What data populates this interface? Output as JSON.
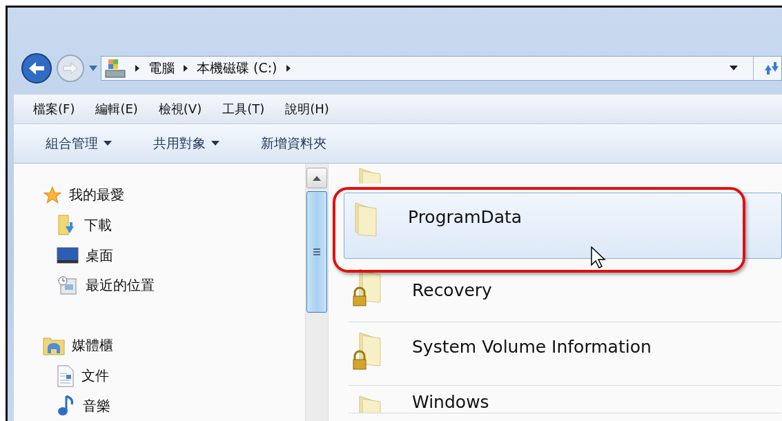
{
  "address_bar": {
    "crumbs": [
      "電腦",
      "本機磁碟 (C:)"
    ]
  },
  "menu_bar": [
    "檔案(F)",
    "編輯(E)",
    "檢視(V)",
    "工具(T)",
    "說明(H)"
  ],
  "command_bar": [
    {
      "label": "組合管理",
      "dropdown": true
    },
    {
      "label": "共用對象",
      "dropdown": true
    },
    {
      "label": "新增資料夾",
      "dropdown": false
    }
  ],
  "nav_pane": [
    {
      "label": "我的最愛",
      "kind": "favorites",
      "children": [
        {
          "label": "下載",
          "kind": "downloads"
        },
        {
          "label": "桌面",
          "kind": "desktop"
        },
        {
          "label": "最近的位置",
          "kind": "recent"
        }
      ]
    },
    {
      "label": "媒體櫃",
      "kind": "library",
      "children": [
        {
          "label": "文件",
          "kind": "documents"
        },
        {
          "label": "音樂",
          "kind": "music"
        }
      ]
    }
  ],
  "files": [
    {
      "name": "ProgramData",
      "locked": false,
      "selected": true
    },
    {
      "name": "Recovery",
      "locked": true,
      "selected": false
    },
    {
      "name": "System Volume Information",
      "locked": true,
      "selected": false
    },
    {
      "name": "Windows",
      "locked": false,
      "selected": false
    }
  ]
}
